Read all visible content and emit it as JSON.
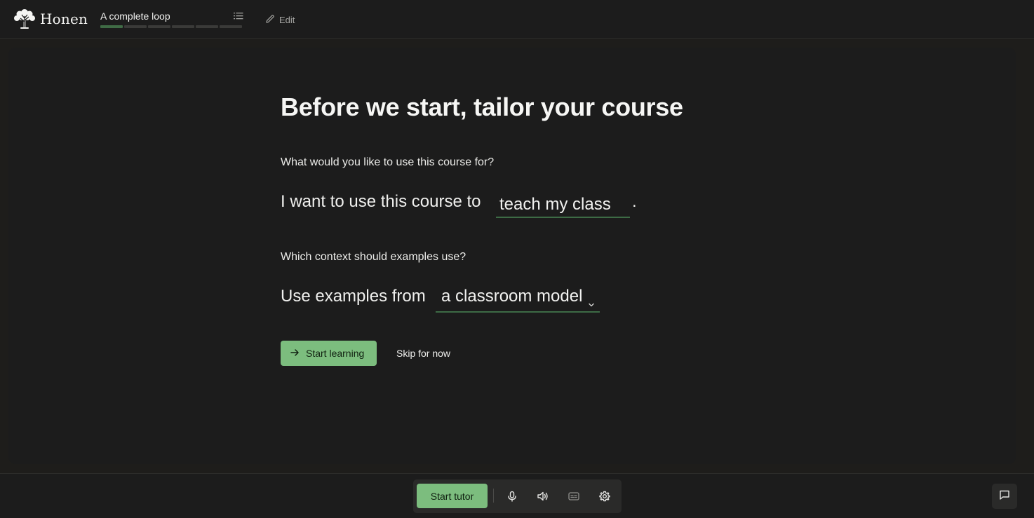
{
  "app": {
    "brand": "Honen"
  },
  "header": {
    "course_title": "A complete loop",
    "progress": {
      "completed_segments": 1,
      "total_segments": 6
    },
    "edit_label": "Edit"
  },
  "main": {
    "heading": "Before we start, tailor your course",
    "question1": {
      "label": "What would you like to use this course for?",
      "sentence_prefix": "I want to use this course to",
      "input_value": "teach my class",
      "sentence_suffix": "."
    },
    "question2": {
      "label": "Which context should examples use?",
      "sentence_prefix": "Use examples from",
      "selected_option": "a classroom model"
    },
    "start_button": "Start learning",
    "skip_button": "Skip for now"
  },
  "bottom_bar": {
    "tutor_button": "Start tutor",
    "icons": [
      "microphone-icon",
      "speaker-icon",
      "captions-icon",
      "gear-icon",
      "chat-icon"
    ]
  },
  "colors": {
    "accent": "#7cbd7e",
    "underline": "#3d6b45",
    "background": "#1c1c1c"
  }
}
